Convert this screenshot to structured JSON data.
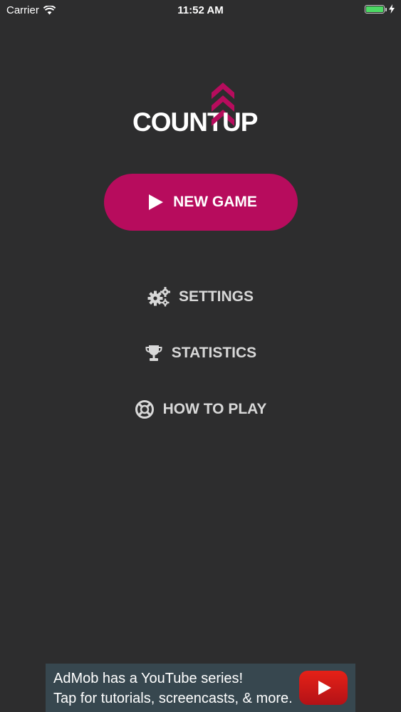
{
  "status_bar": {
    "carrier": "Carrier",
    "time": "11:52 AM",
    "wifi_icon": "wifi-icon",
    "battery_icon": "battery-icon",
    "charging_icon": "charging-bolt-icon",
    "battery_color": "#4cd964"
  },
  "logo": {
    "left_text": "COUNT",
    "right_text": "UP",
    "arrow_icon": "double-chevron-up-icon",
    "accent_color": "#b70c5d"
  },
  "new_game": {
    "label": "NEW GAME",
    "icon": "play-icon",
    "color": "#b70c5d"
  },
  "menu": {
    "settings": {
      "label": "SETTINGS",
      "icon": "gears-icon"
    },
    "statistics": {
      "label": "STATISTICS",
      "icon": "trophy-icon"
    },
    "how_to_play": {
      "label": "HOW TO PLAY",
      "icon": "life-ring-icon"
    }
  },
  "ad": {
    "line1": "AdMob has a YouTube series!",
    "line2": "Tap for tutorials, screencasts, & more.",
    "icon": "youtube-play-icon",
    "background_color": "#37474f"
  }
}
